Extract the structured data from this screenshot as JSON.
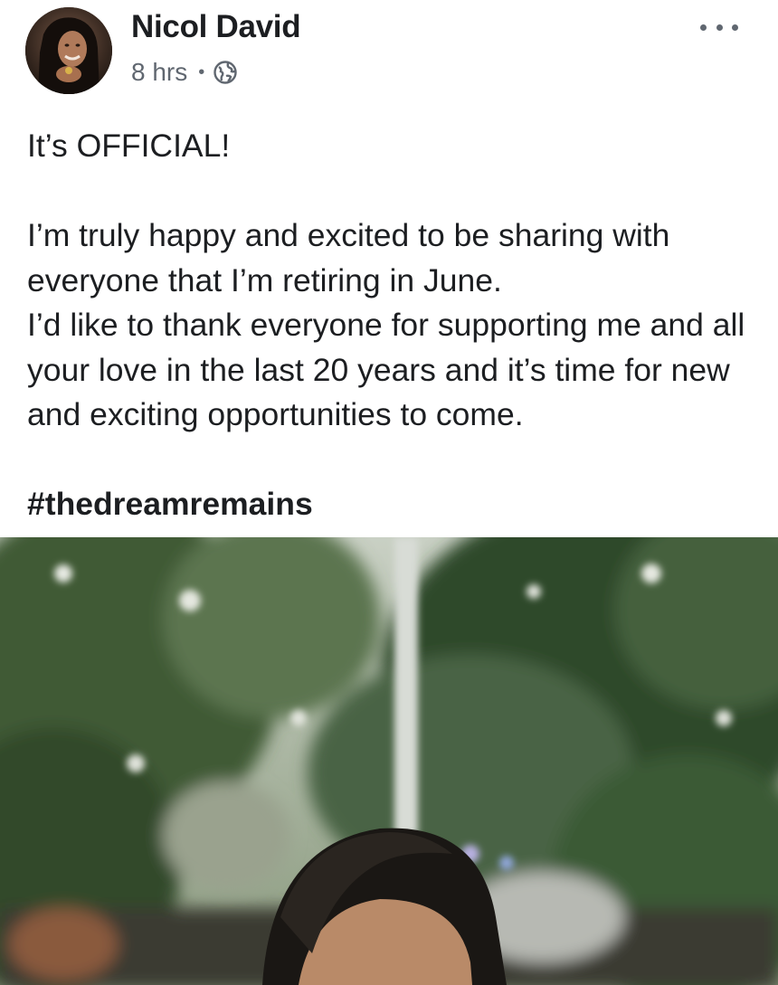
{
  "post": {
    "author": "Nicol David",
    "timestamp": "8 hrs",
    "separator": "•",
    "privacy_icon": "globe-icon",
    "more_icon": "more-options-icon",
    "body_lines": [
      "It’s OFFICIAL!",
      "I’m truly happy and excited to be sharing with everyone that I’m retiring in June.",
      "I’d like to thank everyone for supporting me and all your love in the last 20 years and it’s time for new and exciting opportunities to come."
    ],
    "hashtag": "#thedreamremains"
  },
  "colors": {
    "text_primary": "#1c1e21",
    "text_secondary": "#606770",
    "background": "#ffffff"
  }
}
